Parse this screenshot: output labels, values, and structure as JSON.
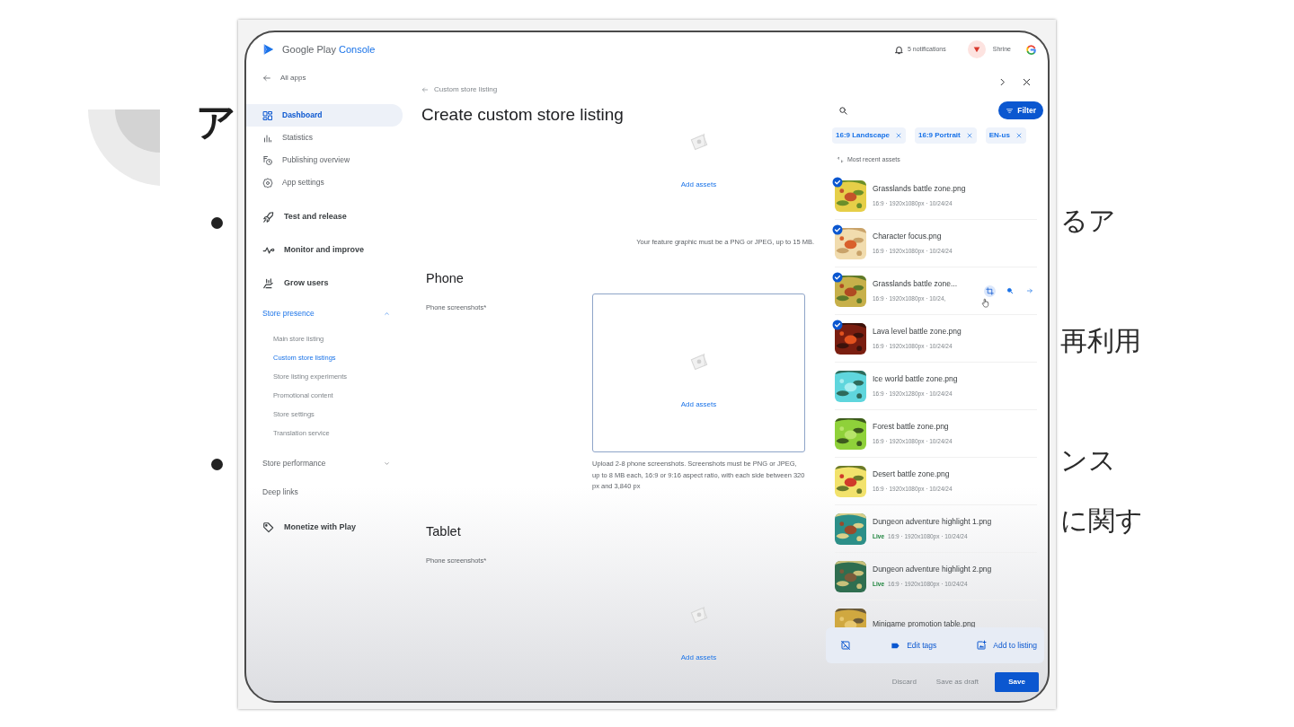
{
  "slide": {
    "title_fragment": "ア",
    "bullets": [
      {
        "fragments": [
          "るア",
          "再利用"
        ]
      },
      {
        "fragments": [
          "ンス",
          "に関す"
        ]
      }
    ]
  },
  "console": {
    "brand": {
      "name": "Google Play",
      "suffix": "Console"
    },
    "header": {
      "notifications": "5 notifications",
      "user": "Shrine"
    },
    "sidebar": {
      "back": "All apps",
      "items": [
        {
          "kind": "primary",
          "label": "Dashboard",
          "selected": true
        },
        {
          "kind": "primary",
          "label": "Statistics",
          "selected": false
        },
        {
          "kind": "primary",
          "label": "Publishing overview",
          "selected": false
        },
        {
          "kind": "primary",
          "label": "App settings",
          "selected": false
        },
        {
          "kind": "section",
          "label": "Test and release",
          "selected": false
        },
        {
          "kind": "section",
          "label": "Monitor and improve",
          "selected": false
        },
        {
          "kind": "section",
          "label": "Grow users",
          "selected": false
        },
        {
          "kind": "group",
          "label": "Store presence",
          "selected": true,
          "expanded": true,
          "children": [
            {
              "label": "Main store listing",
              "selected": false
            },
            {
              "label": "Custom store listings",
              "selected": true
            },
            {
              "label": "Store listing experiments",
              "selected": false
            },
            {
              "label": "Promotional content",
              "selected": false
            },
            {
              "label": "Store settings",
              "selected": false
            },
            {
              "label": "Translation service",
              "selected": false
            }
          ]
        },
        {
          "kind": "group",
          "label": "Store performance",
          "selected": false,
          "expanded": false
        },
        {
          "kind": "link",
          "label": "Deep links",
          "selected": false
        },
        {
          "kind": "section",
          "label": "Monetize with Play",
          "selected": false
        }
      ]
    },
    "main": {
      "breadcrumb": "Custom store listing",
      "title": "Create custom store listing",
      "sections": [
        {
          "kind": "feature",
          "dropzone": {
            "action": "Add assets",
            "focused": false
          },
          "note": "Your feature graphic must be a PNG or JPEG, up to 15 MB."
        },
        {
          "kind": "device",
          "heading": "Phone",
          "field_label": "Phone screenshots*",
          "dropzone": {
            "action": "Add assets",
            "focused": true
          },
          "note": "Upload 2-8 phone screenshots. Screenshots must be PNG or JPEG, up to 8 MB each, 16:9 or 9:16 aspect ratio, with each side between 320 px and 3,840 px"
        },
        {
          "kind": "device",
          "heading": "Tablet",
          "field_label": "Phone screenshots*",
          "dropzone": {
            "action": "Add assets",
            "focused": false
          }
        }
      ]
    },
    "assets_panel": {
      "filter_button": "Filter",
      "chips": [
        {
          "label": "16:9 Landscape"
        },
        {
          "label": "16:9 Portrait"
        },
        {
          "label": "EN-us"
        }
      ],
      "sort_label": "Most recent assets",
      "assets": [
        {
          "name": "Grasslands battle zone.png",
          "meta": "16:9 · 1920x1080px · 10/24/24",
          "selected": true,
          "hovered": false
        },
        {
          "name": "Character focus.png",
          "meta": "16:9 · 1920x1080px · 10/24/24",
          "selected": true,
          "hovered": false
        },
        {
          "name": "Grasslands battle zone...",
          "meta": "16:9 · 1920x1080px · 10/24,",
          "selected": true,
          "hovered": true
        },
        {
          "name": "Lava level battle zone.png",
          "meta": "16:9 · 1920x1080px · 10/24/24",
          "selected": true,
          "hovered": false
        },
        {
          "name": "Ice world battle zone.png",
          "meta": "16:9 · 1920x1280px · 10/24/24",
          "selected": false,
          "hovered": false
        },
        {
          "name": "Forest battle zone.png",
          "meta": "16:9 · 1920x1080px · 10/24/24",
          "selected": false,
          "hovered": false
        },
        {
          "name": "Desert battle zone.png",
          "meta": "16:9 · 1920x1080px · 10/24/24",
          "selected": false,
          "hovered": false
        },
        {
          "name": "Dungeon adventure highlight 1.png",
          "status": "Live",
          "meta": "16:9 · 1920x1080px · 10/24/24",
          "selected": false,
          "hovered": false
        },
        {
          "name": "Dungeon adventure highlight 2.png",
          "status": "Live",
          "meta": "16:9 · 1920x1080px · 10/24/24",
          "selected": false,
          "hovered": false
        },
        {
          "name": "Minigame promotion table.png",
          "selected": false,
          "hovered": false
        }
      ],
      "actions": {
        "edit_tags": "Edit tags",
        "add": "Add to listing"
      }
    },
    "footer": {
      "discard": "Discard",
      "draft": "Save as draft",
      "save": "Save"
    }
  }
}
